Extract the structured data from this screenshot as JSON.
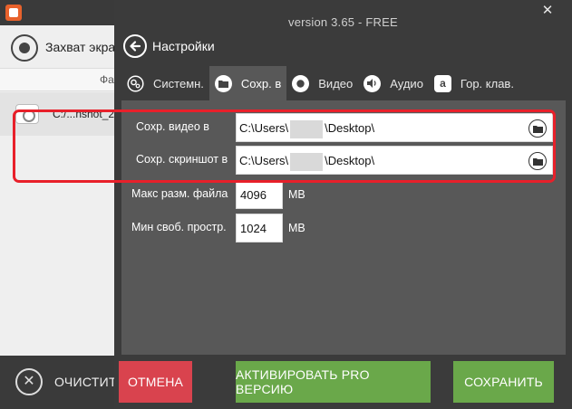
{
  "background_app": {
    "capture_label": "Захват экрана",
    "column_header": "Фа",
    "file_name": "C:/...nshot_2",
    "clear_label": "ОЧИСТИТЬ"
  },
  "dialog": {
    "version": "version 3.65 - FREE",
    "title": "Настройки",
    "tabs": [
      {
        "label": "Системн.",
        "icon": "gears-icon"
      },
      {
        "label": "Сохр. в",
        "icon": "folder-icon",
        "active": true
      },
      {
        "label": "Видео",
        "icon": "record-icon"
      },
      {
        "label": "Аудио",
        "icon": "speaker-icon"
      },
      {
        "label": "Гор. клав.",
        "icon": "hotkey-icon"
      }
    ],
    "save_video": {
      "label": "Сохр. видео в",
      "path_start": "C:\\Users\\",
      "path_end": "\\Desktop\\"
    },
    "save_screenshot": {
      "label": "Сохр. скриншот в",
      "path_start": "C:\\Users\\",
      "path_end": "\\Desktop\\"
    },
    "max_file_size": {
      "label": "Макс разм. файла",
      "value": "4096",
      "unit": "MB"
    },
    "min_free_space": {
      "label": "Мин своб. простр.",
      "value": "1024",
      "unit": "MB"
    },
    "buttons": {
      "cancel": "ОТМЕНА",
      "activate": "АКТИВИРОВАТЬ PRO ВЕРСИЮ",
      "save": "СОХРАНИТЬ"
    }
  },
  "colors": {
    "cancel": "#d9434e",
    "green": "#6aa84a",
    "highlight": "#e8202a",
    "panel": "#585858",
    "dark": "#3b3b3b"
  }
}
